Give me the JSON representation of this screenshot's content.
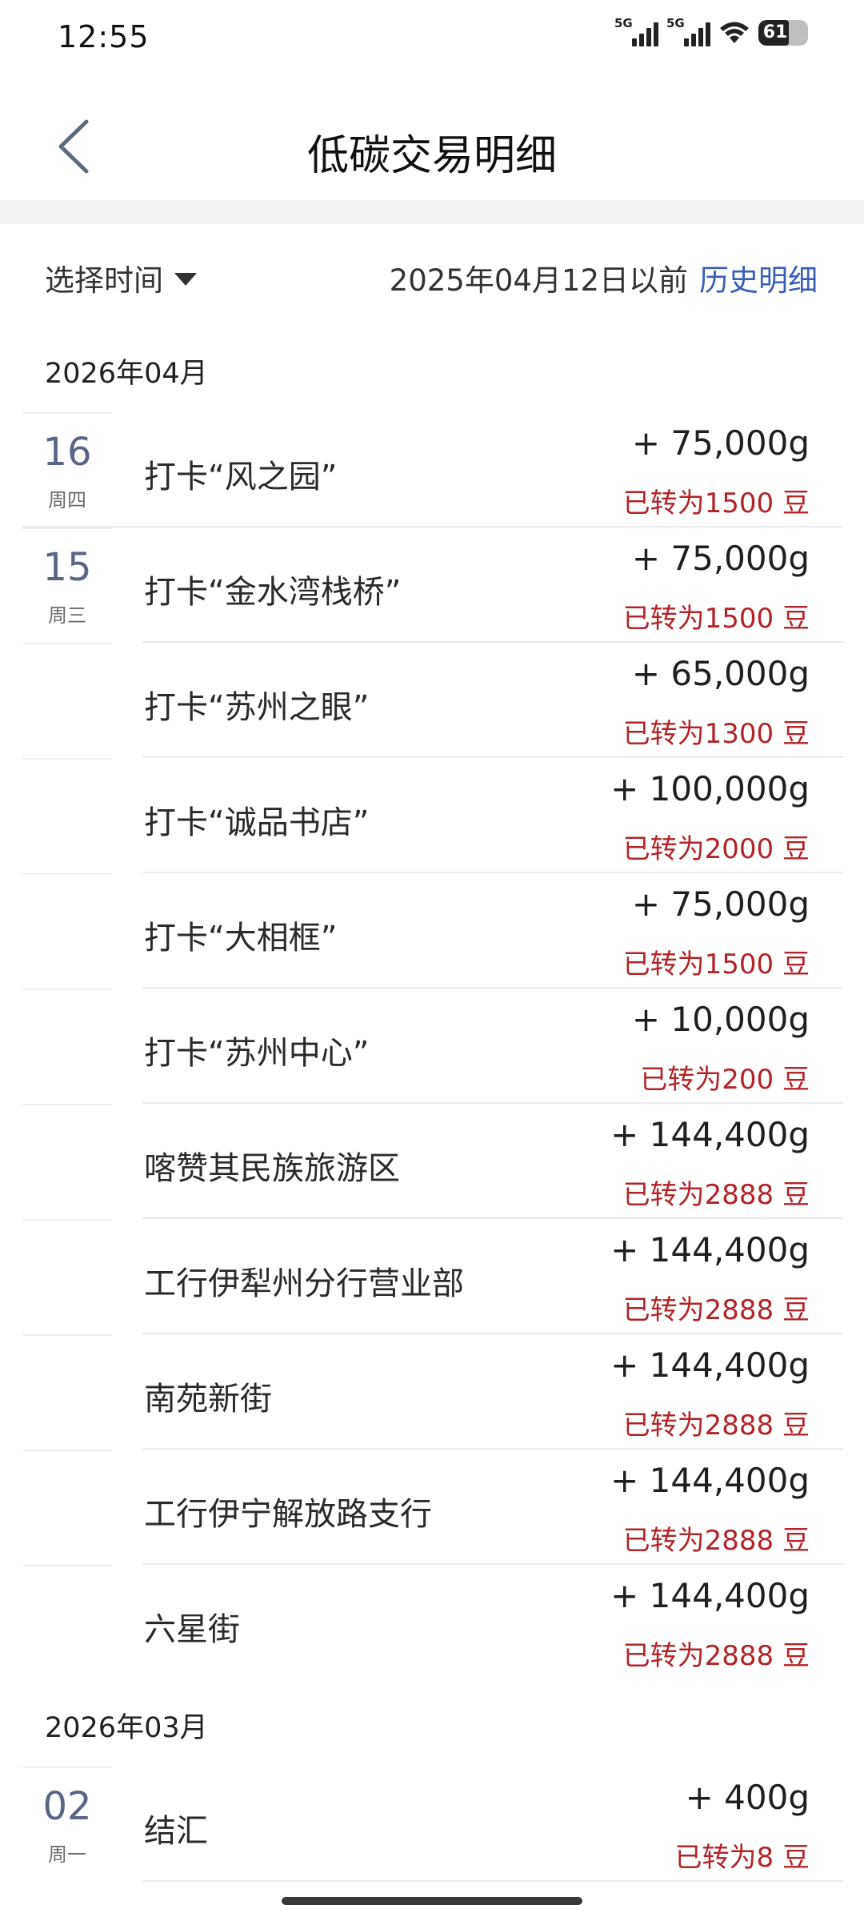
{
  "status_bar": {
    "time": "12:55",
    "network_1": "5G",
    "network_2": "5G",
    "battery": "61",
    "icons": [
      "signal-icon",
      "signal-icon",
      "wifi-icon",
      "battery-icon"
    ]
  },
  "nav": {
    "back_icon": "chevron-left-icon",
    "title": "低碳交易明细"
  },
  "filter": {
    "label": "选择时间",
    "caret_icon": "caret-down-icon",
    "date_note": "2025年04月12日以前",
    "history_link": "历史明细"
  },
  "months": [
    {
      "label": "2026年04月"
    },
    {
      "label": "2026年03月"
    }
  ],
  "colors": {
    "day_number": "#5a6484",
    "converted_text": "#b1242a",
    "history_link": "#3a5db8",
    "band": "#f2f2f4"
  },
  "items": [
    {
      "day": "16",
      "weekday": "周四",
      "desc": "打卡“风之园”",
      "amount": "+ 75,000g",
      "converted": "已转为1500 豆"
    },
    {
      "day": "15",
      "weekday": "周三",
      "desc": "打卡“金水湾栈桥”",
      "amount": "+ 75,000g",
      "converted": "已转为1500 豆"
    },
    {
      "day": "",
      "weekday": "",
      "desc": "打卡“苏州之眼”",
      "amount": "+ 65,000g",
      "converted": "已转为1300 豆"
    },
    {
      "day": "",
      "weekday": "",
      "desc": "打卡“诚品书店”",
      "amount": "+ 100,000g",
      "converted": "已转为2000 豆"
    },
    {
      "day": "",
      "weekday": "",
      "desc": "打卡“大相框”",
      "amount": "+ 75,000g",
      "converted": "已转为1500 豆"
    },
    {
      "day": "",
      "weekday": "",
      "desc": "打卡“苏州中心”",
      "amount": "+ 10,000g",
      "converted": "已转为200 豆"
    },
    {
      "day": "",
      "weekday": "",
      "desc": "喀赞其民族旅游区",
      "amount": "+ 144,400g",
      "converted": "已转为2888 豆"
    },
    {
      "day": "",
      "weekday": "",
      "desc": "工行伊犁州分行营业部",
      "amount": "+ 144,400g",
      "converted": "已转为2888 豆"
    },
    {
      "day": "",
      "weekday": "",
      "desc": "南苑新街",
      "amount": "+ 144,400g",
      "converted": "已转为2888 豆"
    },
    {
      "day": "",
      "weekday": "",
      "desc": "工行伊宁解放路支行",
      "amount": "+ 144,400g",
      "converted": "已转为2888 豆"
    },
    {
      "day": "",
      "weekday": "",
      "desc": "六星街",
      "amount": "+ 144,400g",
      "converted": "已转为2888 豆"
    },
    {
      "day": "02",
      "weekday": "周一",
      "desc": "结汇",
      "amount": "+ 400g",
      "converted": "已转为8 豆"
    }
  ]
}
